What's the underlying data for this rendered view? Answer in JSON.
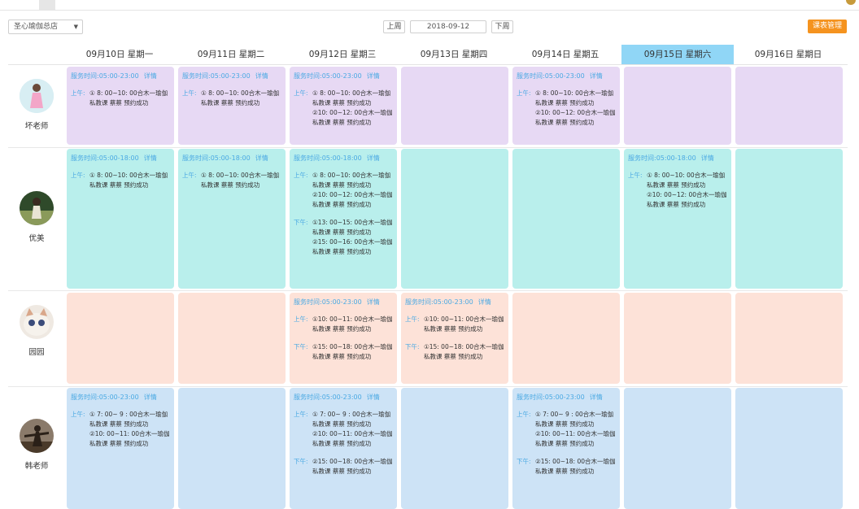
{
  "toolbar": {
    "store": "圣心瑜伽总店",
    "prev_week": "上周",
    "date": "2018-09-12",
    "next_week": "下周",
    "course_mgmt": "课表管理"
  },
  "days": [
    "09月10日 星期一",
    "09月11日 星期二",
    "09月12日 星期三",
    "09月13日 星期四",
    "09月14日 星期五",
    "09月15日 星期六",
    "09月16日 星期日"
  ],
  "colors": {
    "accent": "#f5931f",
    "active_day": "#90d6f6",
    "purple": "#e7d9f4",
    "cyan": "#b9efec",
    "peach": "#fde2d8",
    "blue": "#cde3f6",
    "link": "#4aa9e3"
  },
  "teachers": [
    {
      "name": "坏老师",
      "cells": [
        {
          "service": "服务时间:05:00-23:00",
          "detail": "详情",
          "periods": [
            {
              "label": "上午:",
              "entries": [
                {
                  "line1": "① 8: 00~10: 00合木一瑜伽",
                  "line2": "私教课 蔡蔡 预约成功"
                }
              ]
            }
          ]
        },
        {
          "service": "服务时间:05:00-23:00",
          "detail": "详情",
          "periods": [
            {
              "label": "上午:",
              "entries": [
                {
                  "line1": "① 8: 00~10: 00合木一瑜伽",
                  "line2": "私教课 蔡蔡 预约成功"
                }
              ]
            }
          ]
        },
        {
          "service": "服务时间:05:00-23:00",
          "detail": "详情",
          "periods": [
            {
              "label": "上午:",
              "entries": [
                {
                  "line1": "① 8: 00~10: 00合木一瑜伽",
                  "line2": "私教课 蔡蔡 预约成功"
                },
                {
                  "line1": "②10: 00~12: 00合木一瑜伽",
                  "line2": "私教课 蔡蔡 预约成功"
                }
              ]
            }
          ]
        },
        {},
        {
          "service": "服务时间:05:00-23:00",
          "detail": "详情",
          "periods": [
            {
              "label": "上午:",
              "entries": [
                {
                  "line1": "① 8: 00~10: 00合木一瑜伽",
                  "line2": "私教课 蔡蔡 预约成功"
                },
                {
                  "line1": "②10: 00~12: 00合木一瑜伽",
                  "line2": "私教课 蔡蔡 预约成功"
                }
              ]
            }
          ]
        },
        {},
        {}
      ]
    },
    {
      "name": "优美",
      "cells": [
        {
          "service": "服务时间:05:00-18:00",
          "detail": "详情",
          "periods": [
            {
              "label": "上午:",
              "entries": [
                {
                  "line1": "① 8: 00~10: 00合木一瑜伽",
                  "line2": "私教课 蔡蔡 预约成功"
                }
              ]
            }
          ]
        },
        {
          "service": "服务时间:05:00-18:00",
          "detail": "详情",
          "periods": [
            {
              "label": "上午:",
              "entries": [
                {
                  "line1": "① 8: 00~10: 00合木一瑜伽",
                  "line2": "私教课 蔡蔡 预约成功"
                }
              ]
            }
          ]
        },
        {
          "service": "服务时间:05:00-18:00",
          "detail": "详情",
          "periods": [
            {
              "label": "上午:",
              "entries": [
                {
                  "line1": "① 8: 00~10: 00合木一瑜伽",
                  "line2": "私教课 蔡蔡 预约成功"
                },
                {
                  "line1": "②10: 00~12: 00合木一瑜伽",
                  "line2": "私教课 蔡蔡 预约成功"
                }
              ]
            },
            {
              "label": "下午:",
              "entries": [
                {
                  "line1": "①13: 00~15: 00合木一瑜伽",
                  "line2": "私教课 蔡蔡 预约成功"
                },
                {
                  "line1": "②15: 00~16: 00合木一瑜伽",
                  "line2": "私教课 蔡蔡 预约成功"
                }
              ]
            }
          ]
        },
        {},
        {},
        {
          "service": "服务时间:05:00-18:00",
          "detail": "详情",
          "periods": [
            {
              "label": "上午:",
              "entries": [
                {
                  "line1": "① 8: 00~10: 00合木一瑜伽",
                  "line2": "私教课 蔡蔡 预约成功"
                },
                {
                  "line1": "②10: 00~12: 00合木一瑜伽",
                  "line2": "私教课 蔡蔡 预约成功"
                }
              ]
            }
          ]
        },
        {}
      ]
    },
    {
      "name": "园园",
      "cells": [
        {},
        {},
        {
          "service": "服务时间:05:00-23:00",
          "detail": "详情",
          "periods": [
            {
              "label": "上午:",
              "entries": [
                {
                  "line1": "①10: 00~11: 00合木一瑜伽",
                  "line2": "私教课 蔡蔡 预约成功"
                }
              ]
            },
            {
              "label": "下午:",
              "entries": [
                {
                  "line1": "①15: 00~18: 00合木一瑜伽",
                  "line2": "私教课 蔡蔡 预约成功"
                }
              ]
            }
          ]
        },
        {
          "service": "服务时间:05:00-23:00",
          "detail": "详情",
          "periods": [
            {
              "label": "上午:",
              "entries": [
                {
                  "line1": "①10: 00~11: 00合木一瑜伽",
                  "line2": "私教课 蔡蔡 预约成功"
                }
              ]
            },
            {
              "label": "下午:",
              "entries": [
                {
                  "line1": "①15: 00~18: 00合木一瑜伽",
                  "line2": "私教课 蔡蔡 预约成功"
                }
              ]
            }
          ]
        },
        {},
        {},
        {}
      ]
    },
    {
      "name": "韩老师",
      "cells": [
        {
          "service": "服务时间:05:00-23:00",
          "detail": "详情",
          "periods": [
            {
              "label": "上午:",
              "entries": [
                {
                  "line1": "① 7: 00~ 9 : 00合木一瑜伽",
                  "line2": "私教课 蔡蔡 预约成功"
                },
                {
                  "line1": "②10: 00~11: 00合木一瑜伽",
                  "line2": "私教课 蔡蔡 预约成功"
                }
              ]
            }
          ]
        },
        {},
        {
          "service": "服务时间:05:00-23:00",
          "detail": "详情",
          "periods": [
            {
              "label": "上午:",
              "entries": [
                {
                  "line1": "① 7: 00~ 9 : 00合木一瑜伽",
                  "line2": "私教课 蔡蔡 预约成功"
                },
                {
                  "line1": "②10: 00~11: 00合木一瑜伽",
                  "line2": "私教课 蔡蔡 预约成功"
                }
              ]
            },
            {
              "label": "下午:",
              "entries": [
                {
                  "line1": "②15: 00~18: 00合木一瑜伽",
                  "line2": "私教课 蔡蔡 预约成功"
                }
              ]
            }
          ]
        },
        {},
        {
          "service": "服务时间:05:00-23:00",
          "detail": "详情",
          "periods": [
            {
              "label": "上午:",
              "entries": [
                {
                  "line1": "① 7: 00~ 9 : 00合木一瑜伽",
                  "line2": "私教课 蔡蔡 预约成功"
                },
                {
                  "line1": "②10: 00~11: 00合木一瑜伽",
                  "line2": "私教课 蔡蔡 预约成功"
                }
              ]
            },
            {
              "label": "下午:",
              "entries": [
                {
                  "line1": "②15: 00~18: 00合木一瑜伽",
                  "line2": "私教课 蔡蔡 预约成功"
                }
              ]
            }
          ]
        },
        {},
        {}
      ]
    }
  ]
}
